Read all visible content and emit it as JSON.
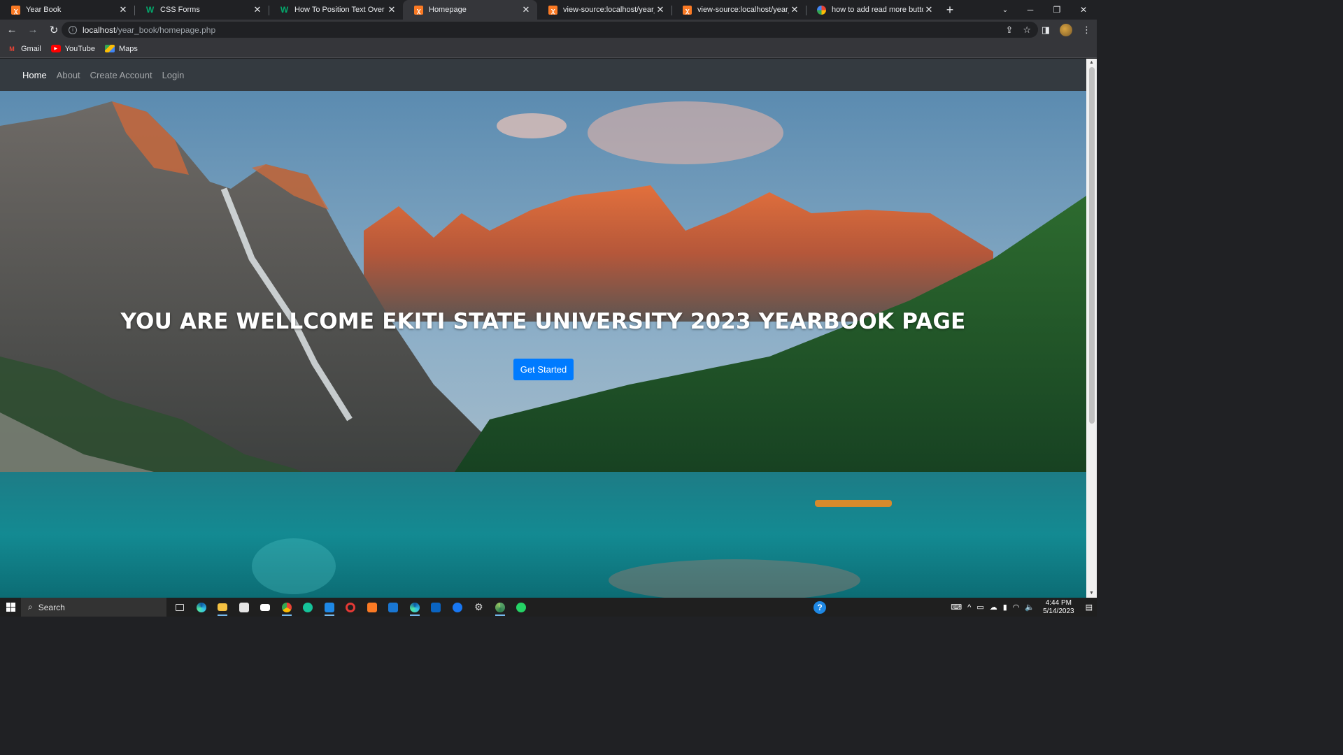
{
  "browser": {
    "tabs": [
      {
        "title": "Year Book",
        "favicon": "xampp-icon",
        "active": false
      },
      {
        "title": "CSS Forms",
        "favicon": "w3schools-icon",
        "active": false
      },
      {
        "title": "How To Position Text Over an Im",
        "favicon": "w3schools-icon",
        "active": false
      },
      {
        "title": "Homepage",
        "favicon": "xampp-icon",
        "active": true
      },
      {
        "title": "view-source:localhost/year_bool",
        "favicon": "xampp-icon",
        "active": false
      },
      {
        "title": "view-source:localhost/year_boo",
        "favicon": "xampp-icon",
        "active": false
      },
      {
        "title": "how to add read more button in",
        "favicon": "google-icon",
        "active": false
      }
    ],
    "url_host": "localhost",
    "url_path": "/year_book/homepage.php",
    "bookmarks": [
      {
        "label": "Gmail",
        "icon": "gmail-icon"
      },
      {
        "label": "YouTube",
        "icon": "youtube-icon"
      },
      {
        "label": "Maps",
        "icon": "maps-icon"
      }
    ]
  },
  "site": {
    "nav": [
      {
        "label": "Home",
        "active": true
      },
      {
        "label": "About",
        "active": false
      },
      {
        "label": "Create Account",
        "active": false
      },
      {
        "label": "Login",
        "active": false
      }
    ],
    "hero": {
      "title": "YOU ARE WELLCOME EKITI STATE UNIVERSITY 2023 YEARBOOK PAGE",
      "button_label": "Get Started",
      "button_color": "#007bff",
      "background": "mountain lake landscape photo"
    },
    "nav_bg": "#343a40"
  },
  "taskbar": {
    "search_label": "Search",
    "time": "4:44 PM",
    "date": "5/14/2023",
    "pinned": [
      "task-view-icon",
      "edge-icon",
      "file-explorer-icon",
      "store-icon",
      "mail-icon",
      "chrome-icon",
      "grammarly-icon",
      "vscode-icon",
      "opera-icon",
      "xampp-icon",
      "app-icon",
      "edge-dev-icon",
      "outlook-icon",
      "facebook-icon",
      "settings-icon",
      "chrome-profile-icon",
      "whatsapp-icon"
    ]
  }
}
